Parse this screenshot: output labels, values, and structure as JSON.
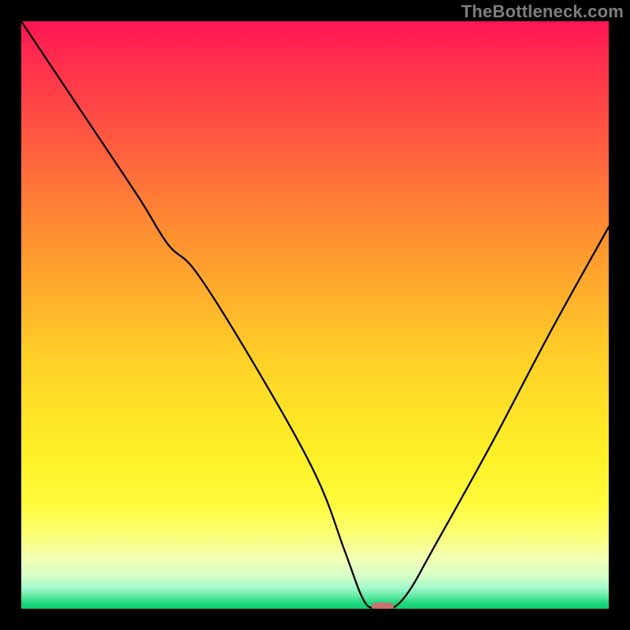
{
  "watermark": "TheBottleneck.com",
  "chart_data": {
    "type": "line",
    "title": "",
    "xlabel": "",
    "ylabel": "",
    "xlim": [
      0,
      100
    ],
    "ylim": [
      0,
      100
    ],
    "grid": false,
    "legend": false,
    "series": [
      {
        "name": "bottleneck-curve",
        "x": [
          0,
          10,
          20,
          25,
          30,
          40,
          50,
          55,
          58,
          60,
          63,
          66,
          70,
          80,
          90,
          100
        ],
        "y": [
          100,
          85,
          70,
          62,
          57,
          41,
          23,
          10,
          2,
          0,
          0,
          3,
          10,
          28,
          47,
          65
        ]
      }
    ],
    "marker": {
      "x": 61.5,
      "y": 0,
      "color": "#d86b6e"
    },
    "background_gradient": {
      "orientation": "vertical",
      "stops": [
        {
          "pos": 0.0,
          "color": "#ff1452"
        },
        {
          "pos": 0.25,
          "color": "#ff6a3c"
        },
        {
          "pos": 0.55,
          "color": "#ffcc28"
        },
        {
          "pos": 0.82,
          "color": "#fffb3c"
        },
        {
          "pos": 0.95,
          "color": "#d4ffc8"
        },
        {
          "pos": 1.0,
          "color": "#0ecd73"
        }
      ]
    }
  }
}
